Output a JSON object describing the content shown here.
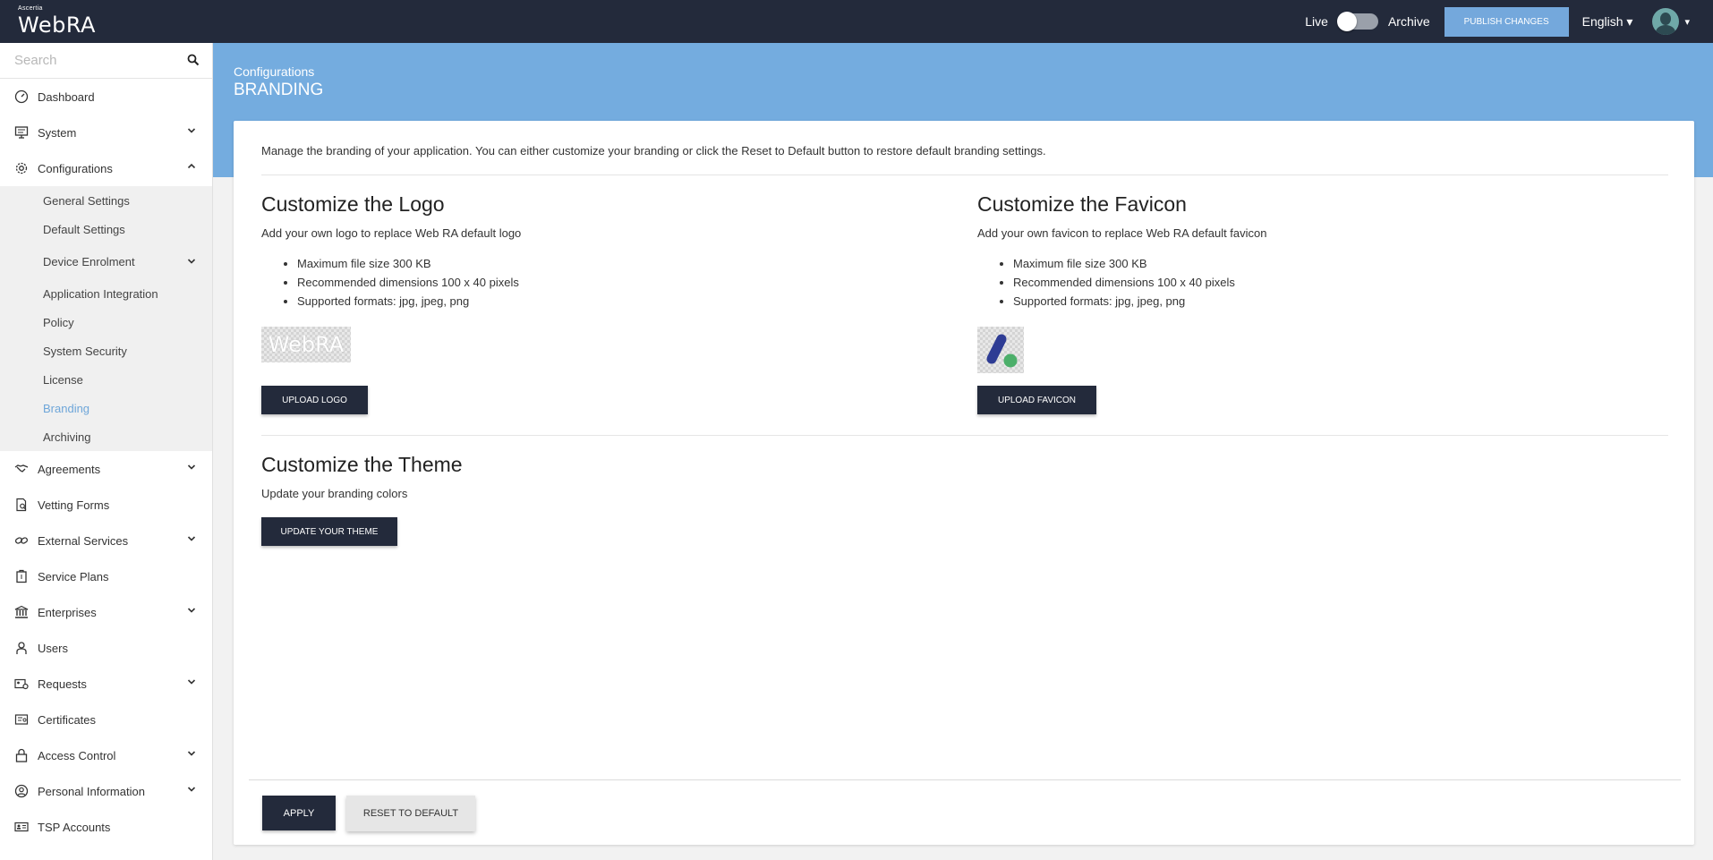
{
  "topbar": {
    "vendor": "Ascertia",
    "product": "WebRA",
    "live_label": "Live",
    "archive_label": "Archive",
    "publish_label": "PUBLISH CHANGES",
    "language": "English ▾",
    "avatar_caret": "▾"
  },
  "sidebar": {
    "search_placeholder": "Search",
    "items": [
      {
        "label": "Dashboard",
        "icon": "dashboard-icon"
      },
      {
        "label": "System",
        "icon": "monitor-icon"
      },
      {
        "label": "Configurations",
        "icon": "gear-icon"
      },
      {
        "label": "Agreements",
        "icon": "handshake-icon"
      },
      {
        "label": "Vetting Forms",
        "icon": "form-search-icon"
      },
      {
        "label": "External Services",
        "icon": "link-icon"
      },
      {
        "label": "Service Plans",
        "icon": "briefcase-icon"
      },
      {
        "label": "Enterprises",
        "icon": "bank-icon"
      },
      {
        "label": "Users",
        "icon": "user-icon"
      },
      {
        "label": "Requests",
        "icon": "id-card-request-icon"
      },
      {
        "label": "Certificates",
        "icon": "certificate-icon"
      },
      {
        "label": "Access Control",
        "icon": "lock-icon"
      },
      {
        "label": "Personal Information",
        "icon": "user-circle-icon"
      },
      {
        "label": "TSP Accounts",
        "icon": "id-card-icon"
      }
    ],
    "config_sub": [
      {
        "label": "General Settings"
      },
      {
        "label": "Default Settings"
      },
      {
        "label": "Device Enrolment"
      },
      {
        "label": "Application Integration"
      },
      {
        "label": "Policy"
      },
      {
        "label": "System Security"
      },
      {
        "label": "License"
      },
      {
        "label": "Branding"
      },
      {
        "label": "Archiving"
      }
    ]
  },
  "header": {
    "breadcrumb": "Configurations",
    "title": "BRANDING"
  },
  "main": {
    "intro": "Manage the branding of your application. You can either customize your branding or click the Reset to Default button to restore default branding settings.",
    "logo": {
      "title": "Customize the Logo",
      "desc": "Add your own logo to replace Web RA default logo",
      "bullets": [
        "Maximum file size 300 KB",
        "Recommended dimensions 100 x 40 pixels",
        "Supported formats: jpg, jpeg, png"
      ],
      "preview_text": "WebRA",
      "button": "UPLOAD LOGO"
    },
    "favicon": {
      "title": "Customize the Favicon",
      "desc": "Add your own favicon to replace Web RA default favicon",
      "bullets": [
        "Maximum file size 300 KB",
        "Recommended dimensions 100 x 40 pixels",
        "Supported formats: jpg, jpeg, png"
      ],
      "button": "UPLOAD FAVICON"
    },
    "theme": {
      "title": "Customize the Theme",
      "desc": "Update your branding colors",
      "button": "UPDATE YOUR THEME"
    },
    "apply_label": "APPLY",
    "reset_label": "RESET TO DEFAULT"
  },
  "colors": {
    "topbar": "#232a3b",
    "accent": "#74acdf",
    "active_link": "#6ea6d9",
    "favicon_blue": "#2e3c94",
    "favicon_green": "#4caf6a"
  }
}
